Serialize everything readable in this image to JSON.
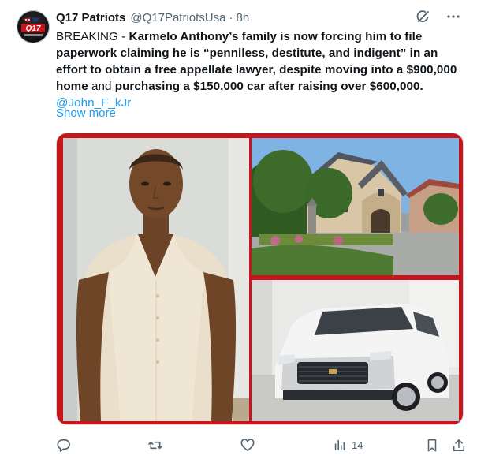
{
  "account": {
    "name": "Q17 Patriots",
    "handle": "@Q17PatriotsUsa",
    "separator": "·",
    "time": "8h",
    "avatar_text": "Q17"
  },
  "tweet": {
    "t1": "BREAKING - ",
    "t2": "Karmelo Anthony’s family is now forcing him to file paperwork claiming he is “penniless, destitute, and indigent” in an effort to obtain a free appellate lawyer, despite moving into a ",
    "t3": "$900,000 home",
    "t4": " and ",
    "t5": "purchasing a $150,000 car after raising over $600,000.",
    "t6": " ",
    "mention": "@John_F_kJr",
    "show_more": "Show more"
  },
  "media": {
    "images": [
      "person-portrait",
      "house-photo",
      "suv-photo"
    ],
    "border_color": "#c8141b"
  },
  "actions": {
    "reply_count": "",
    "retweet_count": "",
    "like_count": "",
    "views_count": "14"
  },
  "icons": {
    "header": [
      "grok-icon",
      "more-icon"
    ],
    "actions": [
      "reply-icon",
      "retweet-icon",
      "like-icon",
      "views-icon",
      "bookmark-icon",
      "share-icon"
    ]
  },
  "colors": {
    "link": "#1d9bf0",
    "text": "#0f1419",
    "muted": "#536471",
    "accent_red": "#c8141b"
  }
}
